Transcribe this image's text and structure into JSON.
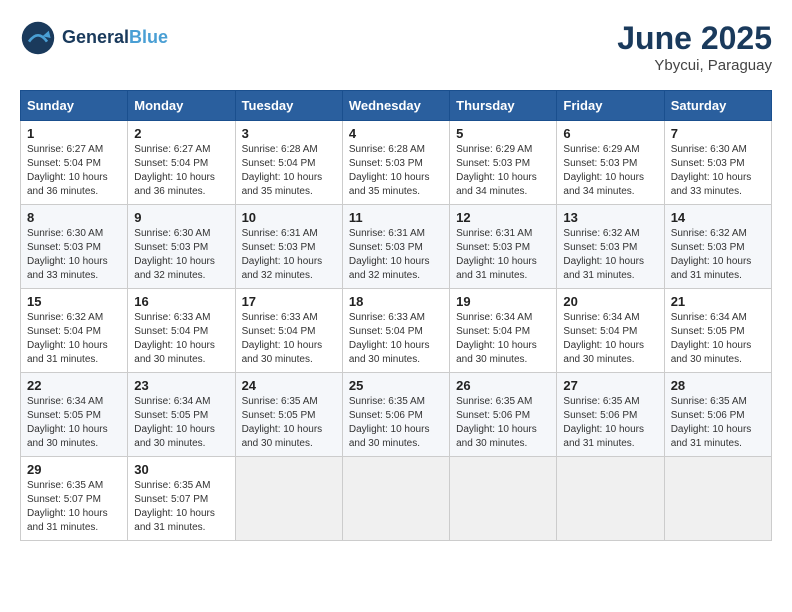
{
  "logo": {
    "line1": "General",
    "line2": "Blue"
  },
  "title": "June 2025",
  "subtitle": "Ybycui, Paraguay",
  "days_of_week": [
    "Sunday",
    "Monday",
    "Tuesday",
    "Wednesday",
    "Thursday",
    "Friday",
    "Saturday"
  ],
  "weeks": [
    [
      {
        "day": "1",
        "info": "Sunrise: 6:27 AM\nSunset: 5:04 PM\nDaylight: 10 hours\nand 36 minutes."
      },
      {
        "day": "2",
        "info": "Sunrise: 6:27 AM\nSunset: 5:04 PM\nDaylight: 10 hours\nand 36 minutes."
      },
      {
        "day": "3",
        "info": "Sunrise: 6:28 AM\nSunset: 5:04 PM\nDaylight: 10 hours\nand 35 minutes."
      },
      {
        "day": "4",
        "info": "Sunrise: 6:28 AM\nSunset: 5:03 PM\nDaylight: 10 hours\nand 35 minutes."
      },
      {
        "day": "5",
        "info": "Sunrise: 6:29 AM\nSunset: 5:03 PM\nDaylight: 10 hours\nand 34 minutes."
      },
      {
        "day": "6",
        "info": "Sunrise: 6:29 AM\nSunset: 5:03 PM\nDaylight: 10 hours\nand 34 minutes."
      },
      {
        "day": "7",
        "info": "Sunrise: 6:30 AM\nSunset: 5:03 PM\nDaylight: 10 hours\nand 33 minutes."
      }
    ],
    [
      {
        "day": "8",
        "info": "Sunrise: 6:30 AM\nSunset: 5:03 PM\nDaylight: 10 hours\nand 33 minutes."
      },
      {
        "day": "9",
        "info": "Sunrise: 6:30 AM\nSunset: 5:03 PM\nDaylight: 10 hours\nand 32 minutes."
      },
      {
        "day": "10",
        "info": "Sunrise: 6:31 AM\nSunset: 5:03 PM\nDaylight: 10 hours\nand 32 minutes."
      },
      {
        "day": "11",
        "info": "Sunrise: 6:31 AM\nSunset: 5:03 PM\nDaylight: 10 hours\nand 32 minutes."
      },
      {
        "day": "12",
        "info": "Sunrise: 6:31 AM\nSunset: 5:03 PM\nDaylight: 10 hours\nand 31 minutes."
      },
      {
        "day": "13",
        "info": "Sunrise: 6:32 AM\nSunset: 5:03 PM\nDaylight: 10 hours\nand 31 minutes."
      },
      {
        "day": "14",
        "info": "Sunrise: 6:32 AM\nSunset: 5:03 PM\nDaylight: 10 hours\nand 31 minutes."
      }
    ],
    [
      {
        "day": "15",
        "info": "Sunrise: 6:32 AM\nSunset: 5:04 PM\nDaylight: 10 hours\nand 31 minutes."
      },
      {
        "day": "16",
        "info": "Sunrise: 6:33 AM\nSunset: 5:04 PM\nDaylight: 10 hours\nand 30 minutes."
      },
      {
        "day": "17",
        "info": "Sunrise: 6:33 AM\nSunset: 5:04 PM\nDaylight: 10 hours\nand 30 minutes."
      },
      {
        "day": "18",
        "info": "Sunrise: 6:33 AM\nSunset: 5:04 PM\nDaylight: 10 hours\nand 30 minutes."
      },
      {
        "day": "19",
        "info": "Sunrise: 6:34 AM\nSunset: 5:04 PM\nDaylight: 10 hours\nand 30 minutes."
      },
      {
        "day": "20",
        "info": "Sunrise: 6:34 AM\nSunset: 5:04 PM\nDaylight: 10 hours\nand 30 minutes."
      },
      {
        "day": "21",
        "info": "Sunrise: 6:34 AM\nSunset: 5:05 PM\nDaylight: 10 hours\nand 30 minutes."
      }
    ],
    [
      {
        "day": "22",
        "info": "Sunrise: 6:34 AM\nSunset: 5:05 PM\nDaylight: 10 hours\nand 30 minutes."
      },
      {
        "day": "23",
        "info": "Sunrise: 6:34 AM\nSunset: 5:05 PM\nDaylight: 10 hours\nand 30 minutes."
      },
      {
        "day": "24",
        "info": "Sunrise: 6:35 AM\nSunset: 5:05 PM\nDaylight: 10 hours\nand 30 minutes."
      },
      {
        "day": "25",
        "info": "Sunrise: 6:35 AM\nSunset: 5:06 PM\nDaylight: 10 hours\nand 30 minutes."
      },
      {
        "day": "26",
        "info": "Sunrise: 6:35 AM\nSunset: 5:06 PM\nDaylight: 10 hours\nand 30 minutes."
      },
      {
        "day": "27",
        "info": "Sunrise: 6:35 AM\nSunset: 5:06 PM\nDaylight: 10 hours\nand 31 minutes."
      },
      {
        "day": "28",
        "info": "Sunrise: 6:35 AM\nSunset: 5:06 PM\nDaylight: 10 hours\nand 31 minutes."
      }
    ],
    [
      {
        "day": "29",
        "info": "Sunrise: 6:35 AM\nSunset: 5:07 PM\nDaylight: 10 hours\nand 31 minutes."
      },
      {
        "day": "30",
        "info": "Sunrise: 6:35 AM\nSunset: 5:07 PM\nDaylight: 10 hours\nand 31 minutes."
      },
      {
        "day": "",
        "info": ""
      },
      {
        "day": "",
        "info": ""
      },
      {
        "day": "",
        "info": ""
      },
      {
        "day": "",
        "info": ""
      },
      {
        "day": "",
        "info": ""
      }
    ]
  ]
}
